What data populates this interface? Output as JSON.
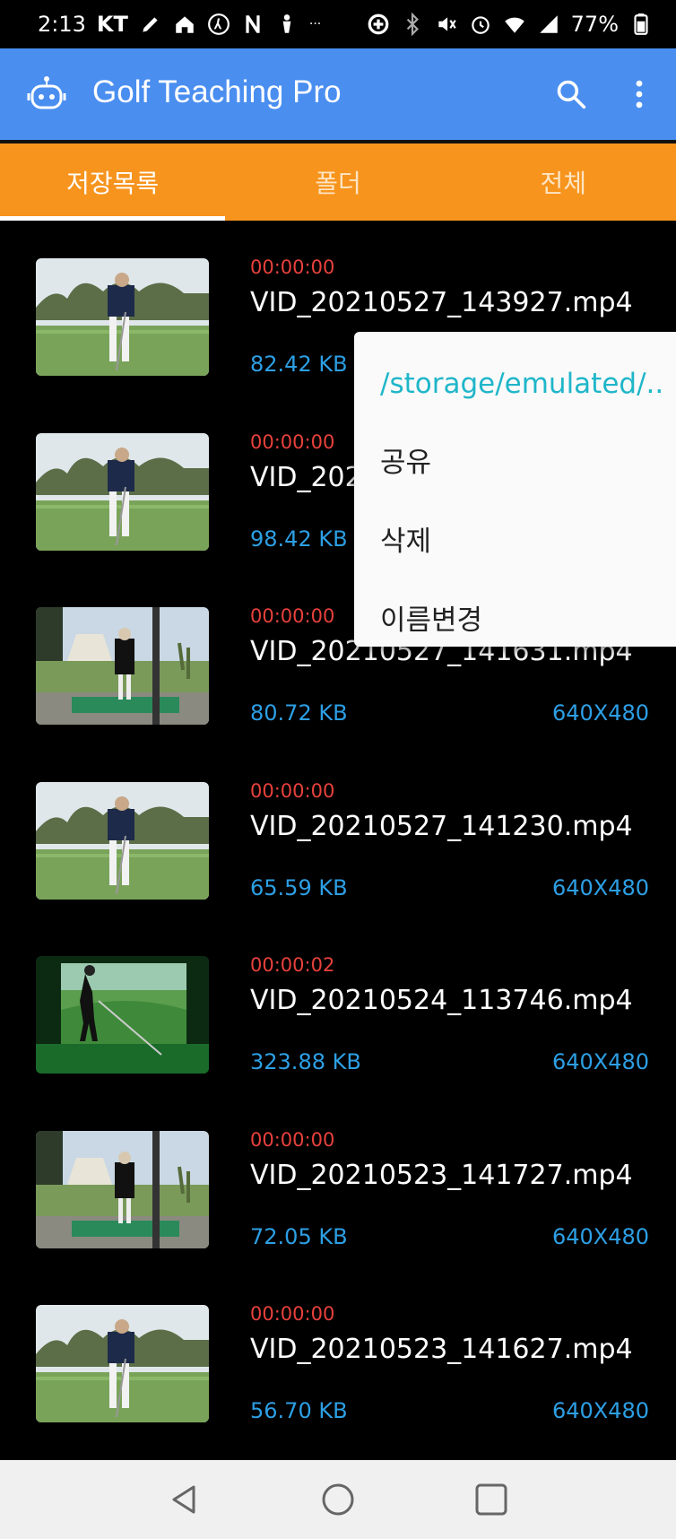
{
  "status_bar": {
    "time": "2:13",
    "carrier": "KT",
    "extra": "···",
    "battery": "77%",
    "icons_left": [
      "pencil-icon",
      "home-icon",
      "walk-icon",
      "n-icon",
      "golfer-icon"
    ],
    "icons_right": [
      "data-saver-icon",
      "bluetooth-icon",
      "mute-icon",
      "alarm-icon",
      "wifi-icon",
      "signal-icon",
      "battery-icon"
    ]
  },
  "app_bar": {
    "title": "Golf Teaching Pro",
    "icon": "robot-icon",
    "color": "#4a8ef0"
  },
  "tabs": [
    {
      "label": "저장목록",
      "active": true
    },
    {
      "label": "폴더",
      "active": false
    },
    {
      "label": "전체",
      "active": false
    }
  ],
  "tab_color": "#f7941d",
  "videos": [
    {
      "duration": "00:00:00",
      "name": "VID_20210527_143927.mp4",
      "size": "82.42 KB",
      "resolution": "",
      "scene": "range"
    },
    {
      "duration": "00:00:00",
      "name": "VID_202",
      "size": "98.42 KB",
      "resolution": "",
      "scene": "range2"
    },
    {
      "duration": "00:00:00",
      "name": "VID_20210527_141631.mp4",
      "size": "80.72 KB",
      "resolution": "640X480",
      "scene": "bay"
    },
    {
      "duration": "00:00:00",
      "name": "VID_20210527_141230.mp4",
      "size": "65.59 KB",
      "resolution": "640X480",
      "scene": "range"
    },
    {
      "duration": "00:00:02",
      "name": "VID_20210524_113746.mp4",
      "size": "323.88 KB",
      "resolution": "640X480",
      "scene": "sim"
    },
    {
      "duration": "00:00:00",
      "name": "VID_20210523_141727.mp4",
      "size": "72.05 KB",
      "resolution": "640X480",
      "scene": "bay"
    },
    {
      "duration": "00:00:00",
      "name": "VID_20210523_141627.mp4",
      "size": "56.70 KB",
      "resolution": "640X480",
      "scene": "range"
    }
  ],
  "popup_menu": {
    "path": "/storage/emulated/..",
    "items": [
      "공유",
      "삭제",
      "이름변경"
    ]
  },
  "nav_bar": {
    "icons": [
      "back-icon",
      "home-icon",
      "recents-icon"
    ]
  }
}
